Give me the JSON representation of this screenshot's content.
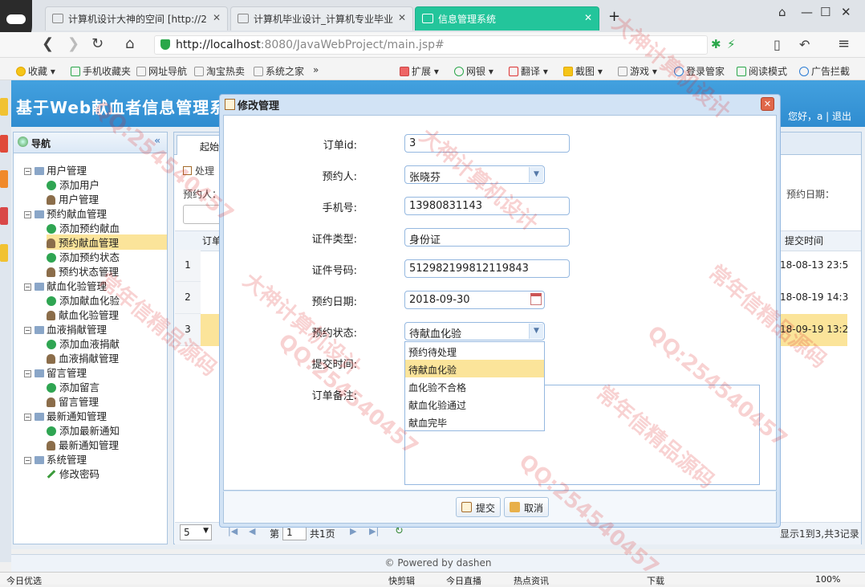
{
  "browser": {
    "tabs": [
      {
        "title": "计算机设计大神的空间 [http://2"
      },
      {
        "title": "计算机毕业设计_计算机专业毕业"
      },
      {
        "title": "信息管理系统"
      }
    ],
    "new_tab": "+",
    "url_host": "http://localhost",
    "url_rest": ":8080/JavaWebProject/main.jsp#",
    "bookmarks": [
      "收藏",
      "手机收藏夹",
      "网址导航",
      "淘宝热卖",
      "系统之家",
      "»",
      "扩展",
      "网银",
      "翻译",
      "截图",
      "游戏",
      "登录管家",
      "阅读模式",
      "广告拦截"
    ]
  },
  "app": {
    "title": "基于Web献血者信息管理系统",
    "greeting": "您好，a | 退出",
    "nav": {
      "title": "导航",
      "collapse": "«",
      "groups": [
        {
          "label": "用户管理",
          "items": [
            {
              "label": "添加用户",
              "kind": "add"
            },
            {
              "label": "用户管理",
              "kind": "user"
            }
          ]
        },
        {
          "label": "预约献血管理",
          "items": [
            {
              "label": "添加预约献血",
              "kind": "add"
            },
            {
              "label": "预约献血管理",
              "kind": "user"
            },
            {
              "label": "添加预约状态",
              "kind": "add"
            },
            {
              "label": "预约状态管理",
              "kind": "user"
            }
          ]
        },
        {
          "label": "献血化验管理",
          "items": [
            {
              "label": "添加献血化验",
              "kind": "add"
            },
            {
              "label": "献血化验管理",
              "kind": "user"
            }
          ]
        },
        {
          "label": "血液捐献管理",
          "items": [
            {
              "label": "添加血液捐献",
              "kind": "add"
            },
            {
              "label": "血液捐献管理",
              "kind": "user"
            }
          ]
        },
        {
          "label": "留言管理",
          "items": [
            {
              "label": "添加留言",
              "kind": "add"
            },
            {
              "label": "留言管理",
              "kind": "user"
            }
          ]
        },
        {
          "label": "最新通知管理",
          "items": [
            {
              "label": "添加最新通知",
              "kind": "add"
            },
            {
              "label": "最新通知管理",
              "kind": "user"
            }
          ]
        },
        {
          "label": "系统管理",
          "items": [
            {
              "label": "修改密码",
              "kind": "pen"
            }
          ]
        }
      ]
    },
    "main": {
      "tab_start": "起始",
      "toolbar_process": "处理",
      "filter_person": "预约人：",
      "filter_date": "预约日期：",
      "col_id": "订单",
      "col_time": "提交时间",
      "rows": [
        {
          "num": "1",
          "time": "18-08-13 23:5"
        },
        {
          "num": "2",
          "time": "18-08-19 14:3"
        },
        {
          "num": "3",
          "time": "18-09-19 13:2"
        }
      ],
      "pager": {
        "size": "5",
        "page_label": "第",
        "page": "1",
        "total": "共1页",
        "info": "显示1到3,共3记录"
      }
    },
    "footer": "© Powered by dashen"
  },
  "dialog": {
    "title": "修改管理",
    "close": "✕",
    "fields": {
      "order_id": {
        "label": "订单id:",
        "value": "3"
      },
      "person": {
        "label": "预约人:",
        "value": "张晓芬"
      },
      "phone": {
        "label": "手机号:",
        "value": "13980831143"
      },
      "cert_type": {
        "label": "证件类型:",
        "value": "身份证"
      },
      "cert_no": {
        "label": "证件号码:",
        "value": "512982199812119843"
      },
      "date": {
        "label": "预约日期:",
        "value": "2018-09-30"
      },
      "state": {
        "label": "预约状态:",
        "value": "待献血化验"
      },
      "submit_time": {
        "label": "提交时间:"
      },
      "remark": {
        "label": "订单备注:"
      }
    },
    "state_options": [
      "预约待处理",
      "待献血化验",
      "血化验不合格",
      "献血化验通过",
      "献血完毕"
    ],
    "submit": "提交",
    "cancel": "取消"
  },
  "statusbar": [
    "今日优选",
    "快剪辑",
    "今日直播",
    "热点资讯",
    "下载",
    "100%"
  ],
  "watermarks": [
    "QQ:254540457",
    "大神计算机设计",
    "常年信精品源码",
    "QQ:254540457",
    "大神计算机设计",
    "常年信精品源码",
    "QQ:254540457",
    "常年信精品源码",
    "QQ:254540457",
    "大神计算机设计"
  ],
  "colors": {
    "accent": "#2f8cd0",
    "tab_active": "#23c59b",
    "highlight": "#fbe49a"
  }
}
